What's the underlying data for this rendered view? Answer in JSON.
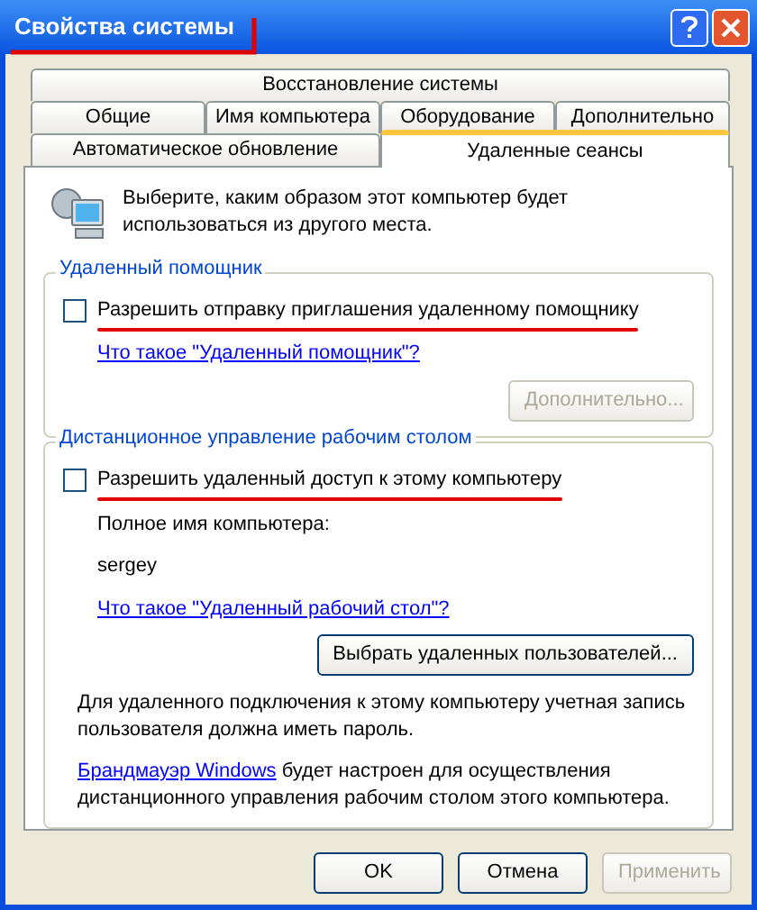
{
  "window": {
    "title": "Свойства системы",
    "title_annotated": true
  },
  "tab_rows": [
    [
      {
        "label": "Восстановление системы",
        "selected": false
      }
    ],
    [
      {
        "label": "Общие",
        "selected": false
      },
      {
        "label": "Имя компьютера",
        "selected": false
      },
      {
        "label": "Оборудование",
        "selected": false
      },
      {
        "label": "Дополнительно",
        "selected": false
      }
    ],
    [
      {
        "label": "Автоматическое обновление",
        "selected": false
      },
      {
        "label": "Удаленные сеансы",
        "selected": true
      }
    ]
  ],
  "intro": "Выберите, каким образом этот компьютер будет использоваться из другого места.",
  "remote_assistance": {
    "legend": "Удаленный помощник",
    "checkbox": {
      "label": "Разрешить отправку приглашения удаленному помощнику",
      "checked": false,
      "annotated": true
    },
    "link": "Что такое \"Удаленный помощник\"?",
    "button": {
      "label": "Дополнительно...",
      "disabled": true
    }
  },
  "remote_desktop": {
    "legend": "Дистанционное управление рабочим столом",
    "checkbox": {
      "label": "Разрешить удаленный доступ к этому компьютеру",
      "checked": false,
      "annotated": true
    },
    "name_label": "Полное имя компьютера:",
    "computer_name": "sergey",
    "link": "Что такое \"Удаленный рабочий стол\"?",
    "button": {
      "label": "Выбрать удаленных пользователей...",
      "disabled": false
    },
    "note": "Для удаленного подключения к этому компьютеру учетная запись пользователя должна иметь пароль.",
    "firewall": {
      "link": "Брандмауэр Windows",
      "text": " будет настроен для осуществления дистанционного управления рабочим столом этого компьютера."
    }
  },
  "buttons": [
    {
      "label": "OK",
      "disabled": false
    },
    {
      "label": "Отмена",
      "disabled": false
    },
    {
      "label": "Применить",
      "disabled": true
    }
  ]
}
